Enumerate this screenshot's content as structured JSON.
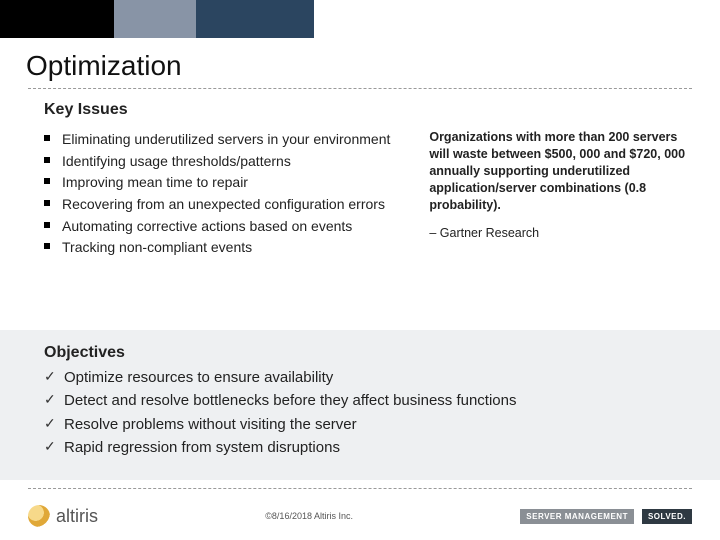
{
  "title": "Optimization",
  "key_issues_heading": "Key Issues",
  "key_issues": [
    "Eliminating underutilized servers in your environment",
    "Identifying usage thresholds/patterns",
    "Improving mean time to repair",
    "Recovering from an unexpected configuration errors",
    "Automating corrective actions based on events",
    "Tracking non-compliant events"
  ],
  "callout": {
    "bold": "Organizations with more than 200 servers will waste between $500, 000 and $720, 000 annually supporting underutilized application/server combinations (0.8 probability).",
    "attribution": "– Gartner Research"
  },
  "objectives_heading": "Objectives",
  "objectives": [
    "Optimize resources to ensure availability",
    "Detect and resolve bottlenecks before they affect business functions",
    "Resolve problems without visiting the server",
    "Rapid regression from system disruptions"
  ],
  "footer": {
    "brand": "altiris",
    "copyright": "©8/16/2018 Altiris Inc.",
    "badge1": "SERVER MANAGEMENT",
    "badge2": "SOLVED."
  }
}
